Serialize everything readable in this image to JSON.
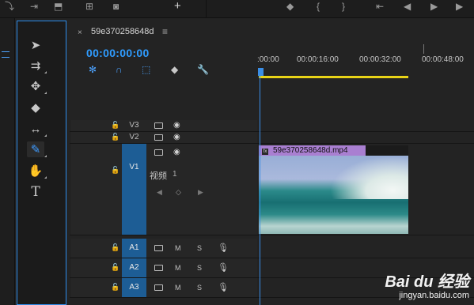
{
  "topbar": {
    "plus_label": "+",
    "transport_icons": [
      "marker-icon",
      "in-point-icon",
      "out-point-icon",
      "go-to-in-icon",
      "step-back-icon",
      "play-icon",
      "step-forward-icon"
    ]
  },
  "tools": {
    "items": [
      {
        "name": "selection-tool",
        "glyph": "➤"
      },
      {
        "name": "track-select-tool",
        "glyph": "⇉"
      },
      {
        "name": "ripple-edit-tool",
        "glyph": "✥"
      },
      {
        "name": "razor-tool",
        "glyph": "◆"
      },
      {
        "name": "slip-tool",
        "glyph": "↔"
      },
      {
        "name": "pen-tool",
        "glyph": "✎"
      },
      {
        "name": "hand-tool",
        "glyph": "✋"
      },
      {
        "name": "type-tool",
        "glyph": "T"
      }
    ]
  },
  "timeline": {
    "tab_close": "×",
    "sequence_name": "59e370258648d",
    "tab_menu": "≡",
    "timecode": "00:00:00:00",
    "ruler_ticks": [
      ":00:00",
      "00:00:16:00",
      "00:00:32:00",
      "00:00:48:00"
    ],
    "tracks": {
      "video": [
        {
          "name": "V3",
          "selected": false
        },
        {
          "name": "V2",
          "selected": false
        },
        {
          "name": "V1",
          "selected": true,
          "label": "视频",
          "index": "1"
        }
      ],
      "audio": [
        {
          "name": "A1",
          "m": "M",
          "s": "S"
        },
        {
          "name": "A2",
          "m": "M",
          "s": "S"
        },
        {
          "name": "A3",
          "m": "M",
          "s": "S"
        }
      ]
    },
    "clip": {
      "label": "59e370258648d.mp4",
      "fx_badge": "fx"
    }
  },
  "watermark": {
    "logo": "Bai du 经验",
    "url": "jingyan.baidu.com"
  },
  "colors": {
    "accent": "#2f9cff",
    "work_area": "#e8d317",
    "clip_label": "#a97fd1",
    "track_selected": "#1d5d95"
  }
}
